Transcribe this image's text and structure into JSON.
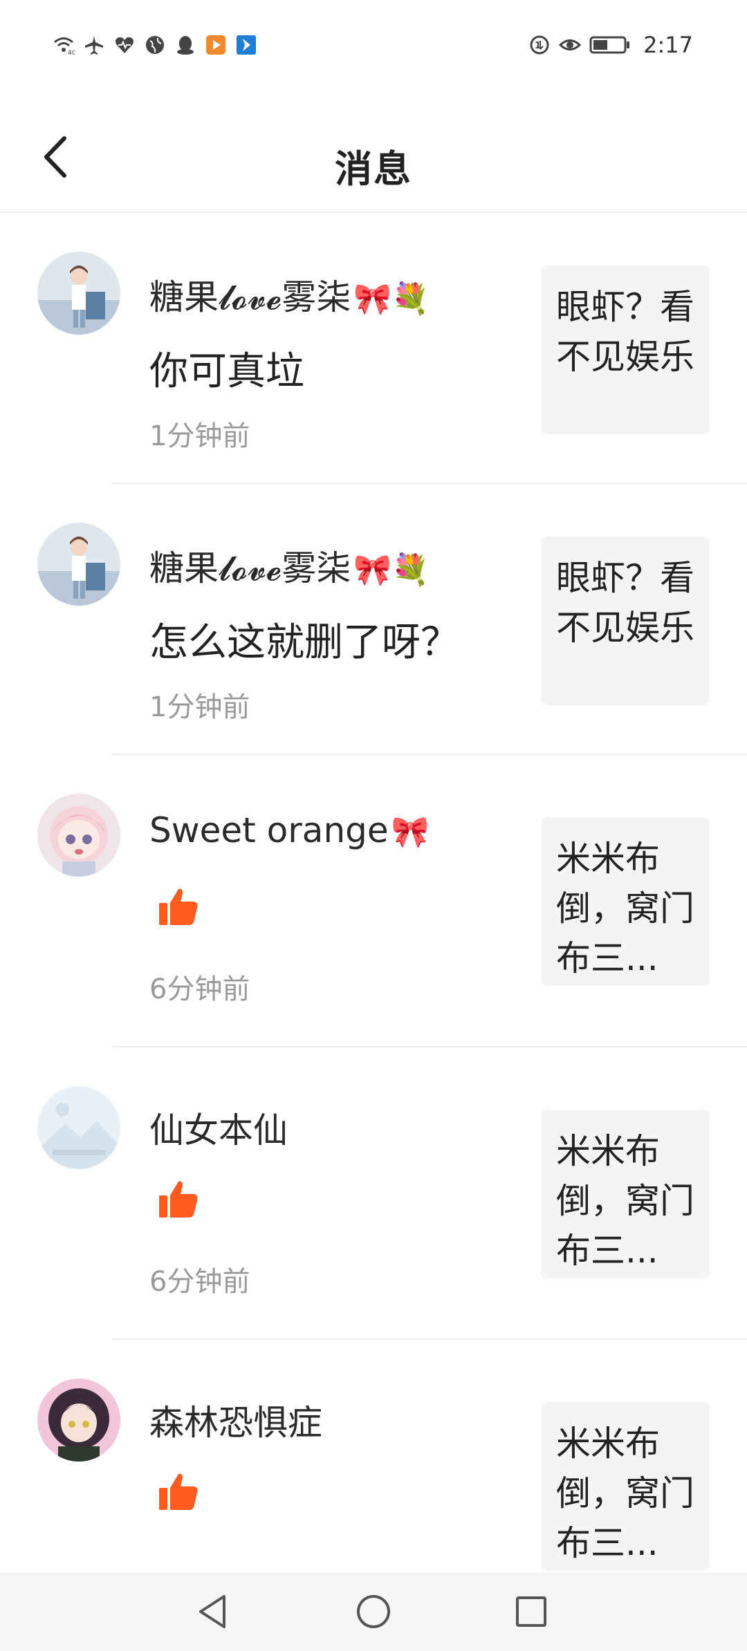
{
  "status_bar": {
    "time": "2:17",
    "icons_left": [
      "wifi-icon",
      "airplane-mode-icon",
      "heart-rate-icon",
      "globe-icon",
      "qq-icon",
      "video-app-icon",
      "app-arrow-icon"
    ],
    "icons_right": [
      "data-saver-icon",
      "eye-icon",
      "battery-icon"
    ]
  },
  "header": {
    "title": "消息",
    "back_icon": "chevron-left-icon"
  },
  "messages": [
    {
      "nickname": "糖果𝓵𝓸𝓿𝓮雾柒",
      "emoji": "🎀💐",
      "content": "你可真垃",
      "time": "1分钟前",
      "thumb_text": "眼虾？看不见娱乐",
      "avatar": "anime-boy-avatar"
    },
    {
      "nickname": "糖果𝓵𝓸𝓿𝓮雾柒",
      "emoji": "🎀💐",
      "content": "怎么这就删了呀？",
      "time": "1分钟前",
      "thumb_text": "眼虾？看不见娱乐",
      "avatar": "anime-boy-avatar"
    },
    {
      "nickname": "Sweet orange",
      "emoji": "🎀",
      "content": "",
      "like": true,
      "time": "6分钟前",
      "thumb_text": "米米布倒，窝门布三...",
      "avatar": "anime-girl-pink-avatar"
    },
    {
      "nickname": "仙女本仙",
      "emoji": "",
      "content": "",
      "like": true,
      "time": "6分钟前",
      "thumb_text": "米米布倒，窝门布三...",
      "avatar": "placeholder-landscape-avatar"
    },
    {
      "nickname": "森林恐惧症",
      "emoji": "",
      "content": "",
      "like": true,
      "time": "",
      "thumb_text": "米米布倒，窝门布三...",
      "avatar": "anime-girl-dark-avatar"
    }
  ],
  "colors": {
    "like_orange": "#ff5a1f",
    "divider": "#ececec",
    "time_gray": "#9a9a9a",
    "thumb_bg": "#f4f4f4"
  },
  "nav_bar": {
    "buttons": [
      "back-triangle-icon",
      "home-circle-icon",
      "recents-square-icon"
    ]
  }
}
